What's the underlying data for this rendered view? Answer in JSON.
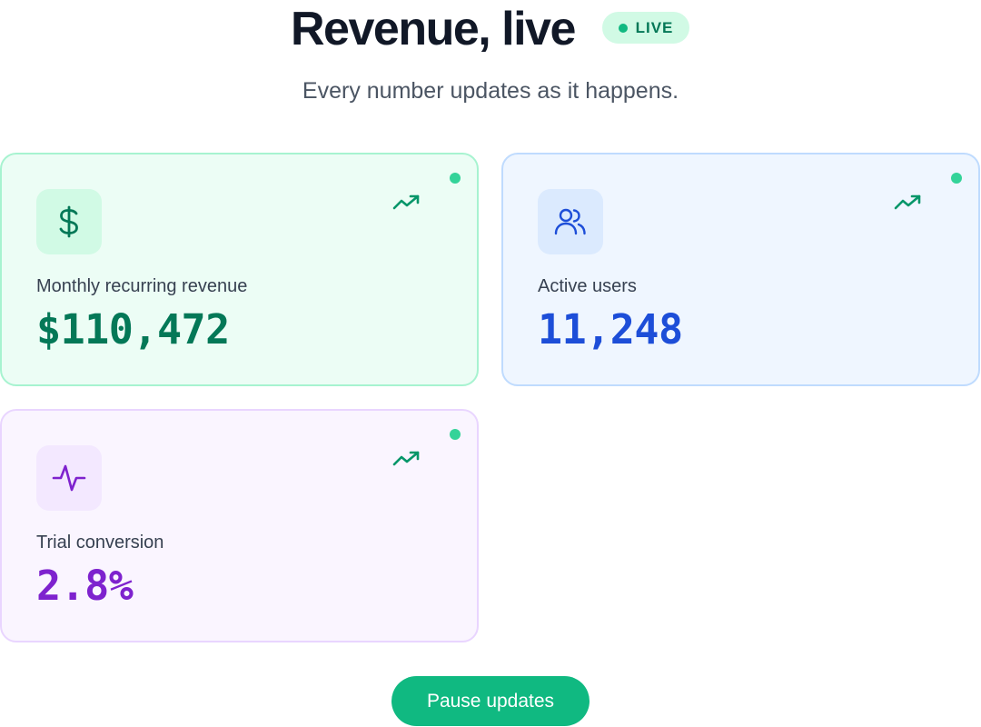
{
  "header": {
    "title": "Revenue, live",
    "badge": "LIVE",
    "subtitle": "Every number updates as it happens."
  },
  "metrics": [
    {
      "label": "Monthly recurring revenue",
      "value": "$110,472",
      "icon": "dollar-icon",
      "trend_icon": "trending-up-icon",
      "accent": "#047857"
    },
    {
      "label": "Active users",
      "value": "11,248",
      "icon": "users-icon",
      "trend_icon": "trending-up-icon",
      "accent": "#1d4ed8"
    },
    {
      "label": "Trial conversion",
      "value": "2.8%",
      "icon": "activity-icon",
      "trend_icon": "trending-up-icon",
      "accent": "#7e22ce"
    }
  ],
  "controls": {
    "pause_label": "Pause updates"
  },
  "colors": {
    "live_green": "#10b981",
    "button": "#10b981"
  }
}
